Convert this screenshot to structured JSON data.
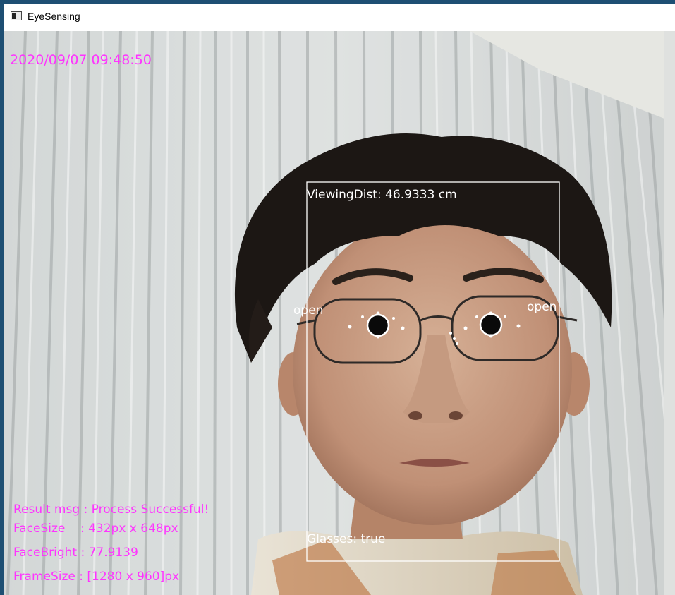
{
  "window": {
    "title": "EyeSensing",
    "icon": "window-app-icon"
  },
  "overlay": {
    "timestamp": "2020/09/07 09:48:50",
    "viewing_distance": "ViewingDist: 46.9333 cm",
    "left_eye_state": "open",
    "right_eye_state": "open",
    "glasses": "Glasses: true",
    "result_msg": "Result msg : Process Successful!",
    "face_size": "FaceSize    : 432px x 648px",
    "face_bright": "FaceBright : 77.9139",
    "frame_size": "FrameSize : [1280 x 960]px"
  },
  "colors": {
    "overlay_text": "#ff33ff",
    "annotation": "#ffffff",
    "window_border": "#1e4f73"
  }
}
